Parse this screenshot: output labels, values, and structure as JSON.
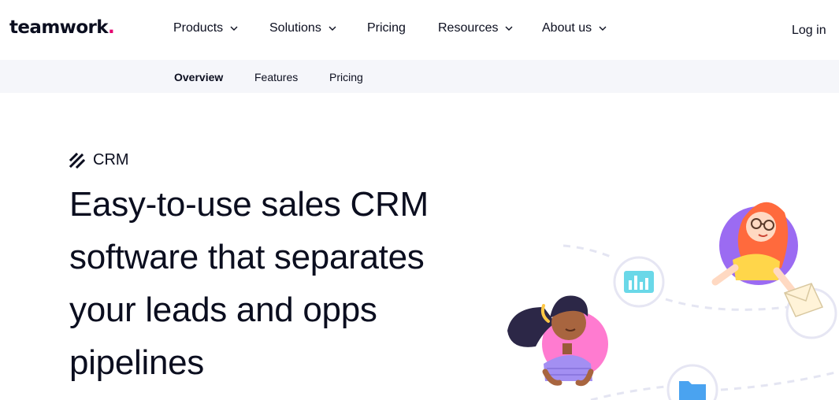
{
  "brand": {
    "name": "teamwork",
    "dot": ".",
    "accent": "#e4006e"
  },
  "nav": {
    "items": [
      {
        "label": "Products",
        "dropdown": true
      },
      {
        "label": "Solutions",
        "dropdown": true
      },
      {
        "label": "Pricing",
        "dropdown": false
      },
      {
        "label": "Resources",
        "dropdown": true
      },
      {
        "label": "About us",
        "dropdown": true
      }
    ],
    "login": "Log in"
  },
  "subnav": {
    "items": [
      {
        "label": "Overview",
        "active": true
      },
      {
        "label": "Features",
        "active": false
      },
      {
        "label": "Pricing",
        "active": false
      }
    ]
  },
  "hero": {
    "tag_icon": "crm-stripes-icon",
    "tag": "CRM",
    "headline": "Easy-to-use sales CRM software that separates your leads and opps pipelines"
  },
  "icons": {
    "chevron": "chevron-down-icon",
    "chart": "bar-chart-icon",
    "folder": "folder-icon",
    "envelope": "envelope-icon"
  },
  "colors": {
    "text": "#0b0e1f",
    "subnav_bg": "#f5f6fa",
    "pink_circle": "#ff7bd0",
    "purple_circle": "#9b6bf2",
    "chart_icon": "#6ad8e8",
    "folder_icon": "#4aa3f0"
  }
}
